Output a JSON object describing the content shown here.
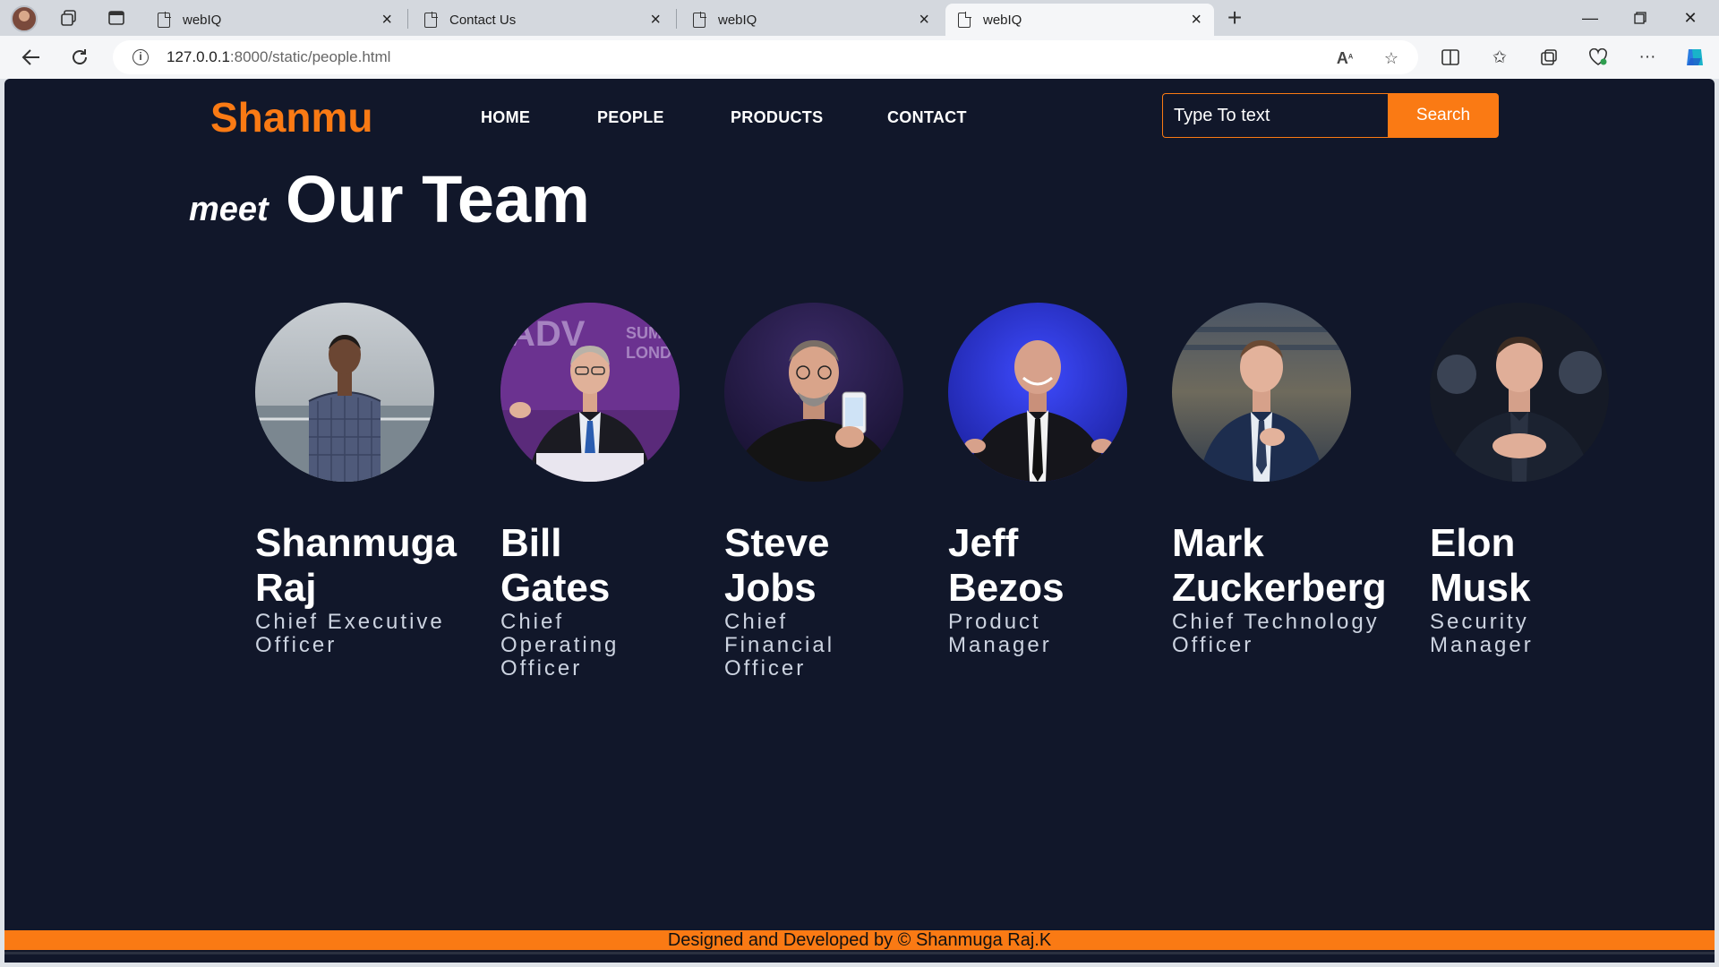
{
  "browser": {
    "tabs": [
      {
        "title": "webIQ",
        "active": false
      },
      {
        "title": "Contact Us",
        "active": false
      },
      {
        "title": "webIQ",
        "active": false
      },
      {
        "title": "webIQ",
        "active": true
      }
    ],
    "url_host": "127.0.0.1",
    "url_rest": ":8000/static/people.html"
  },
  "site": {
    "logo": "Shanmu",
    "nav": [
      "HOME",
      "PEOPLE",
      "PRODUCTS",
      "CONTACT"
    ],
    "search": {
      "placeholder": "Type To text",
      "button": "Search"
    },
    "heading_small": "meet",
    "heading_large": "Our Team",
    "team": [
      {
        "name_line1": "Shanmuga",
        "name_line2": "Raj",
        "role": "Chief Executive Officer"
      },
      {
        "name_line1": "Bill",
        "name_line2": "Gates",
        "role": "Chief Operating Officer"
      },
      {
        "name_line1": "Steve",
        "name_line2": "Jobs",
        "role": "Chief Financial Officer"
      },
      {
        "name_line1": "Jeff",
        "name_line2": "Bezos",
        "role": "Product Manager"
      },
      {
        "name_line1": "Mark",
        "name_line2": "Zuckerberg",
        "role": "Chief Technology Officer"
      },
      {
        "name_line1": "Elon",
        "name_line2": "Musk",
        "role": "Security Manager"
      }
    ],
    "footer": "Designed and Developed by © Shanmuga Raj.K"
  },
  "colors": {
    "accent": "#fa7a14",
    "page_bg": "#11172a"
  }
}
